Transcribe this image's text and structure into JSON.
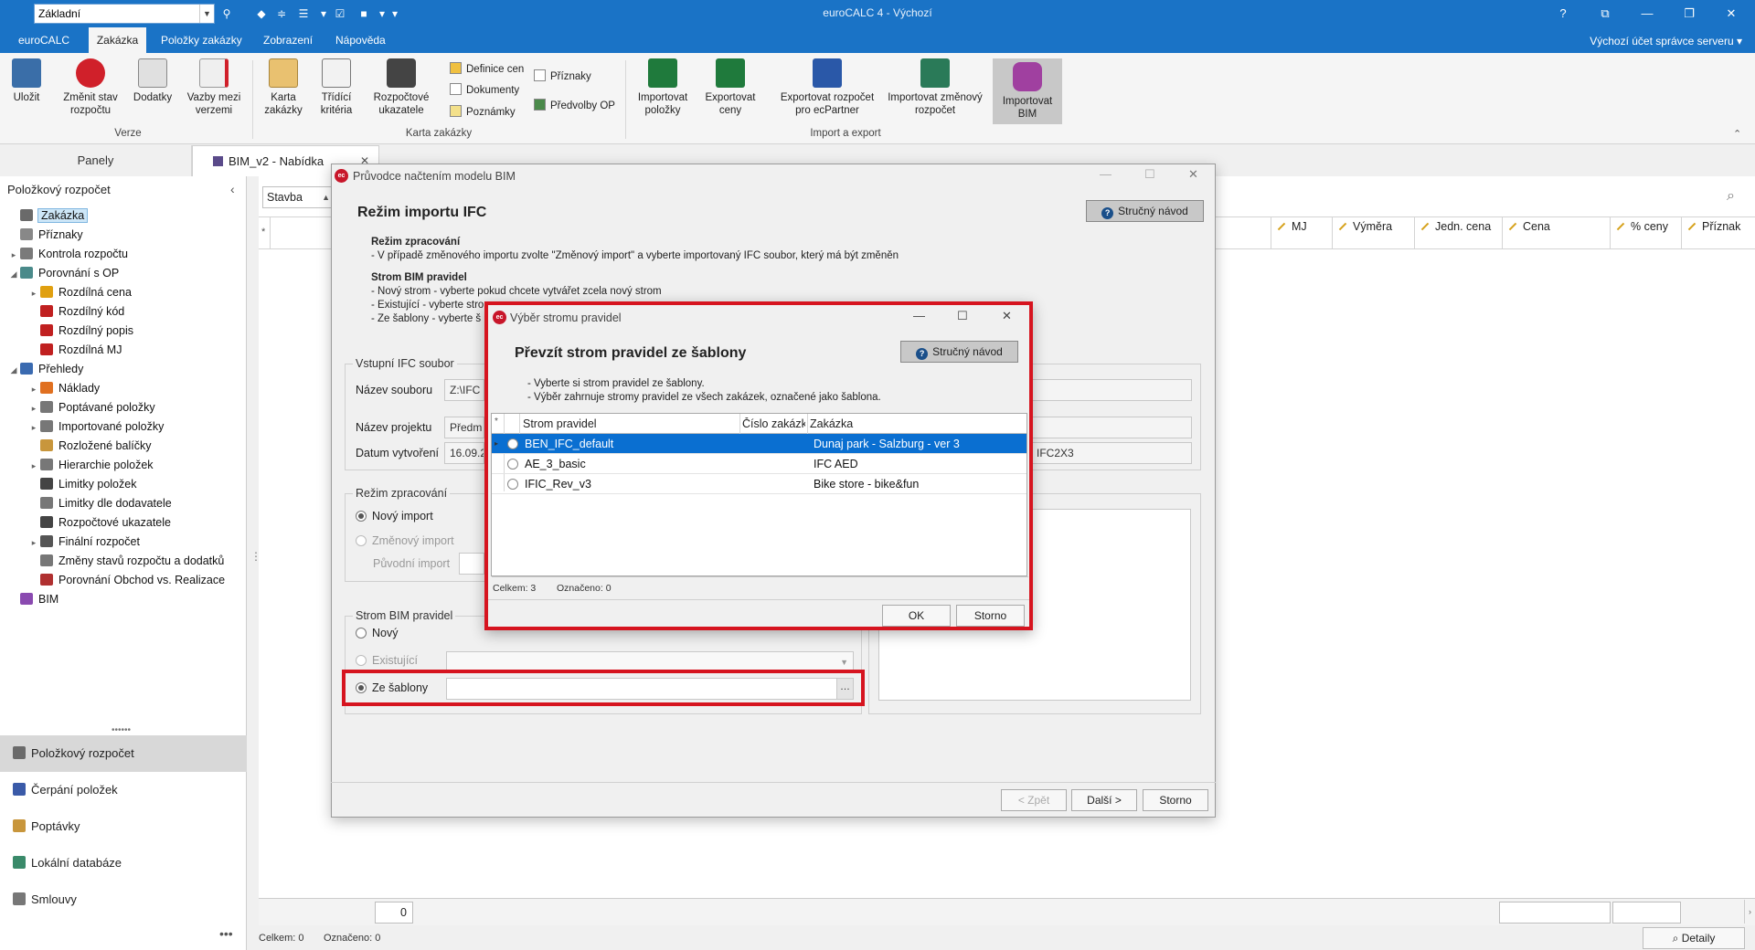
{
  "app": {
    "title": "euroCALC 4 - Výchozí",
    "profile": "Základní",
    "account": "Výchozí účet správce serveru"
  },
  "ribbon": {
    "tabs": [
      "euroCALC",
      "Zakázka",
      "Položky zakázky",
      "Zobrazení",
      "Nápověda"
    ],
    "groups": {
      "verze": {
        "label": "Verze",
        "buttons": [
          "Uložit",
          "Změnit stav rozpočtu",
          "Dodatky",
          "Vazby mezi verzemi"
        ]
      },
      "karta": {
        "label": "Karta zakázky",
        "buttons": [
          "Karta zakázky",
          "Třídící kritéria",
          "Rozpočtové ukazatele"
        ],
        "small": [
          "Definice cen",
          "Dokumenty",
          "Poznámky",
          "Příznaky",
          "Předvolby OP"
        ]
      },
      "import": {
        "label": "Import a export",
        "buttons": [
          "Importovat položky",
          "Exportovat ceny",
          "Exportovat rozpočet pro ecPartner",
          "Importovat změnový rozpočet",
          "Importovat BIM"
        ]
      }
    }
  },
  "left": {
    "panels_label": "Panely",
    "title": "Položkový rozpočet",
    "tree": [
      {
        "label": "Zakázka",
        "level": 0,
        "selected": true,
        "color": "#6a6a6a"
      },
      {
        "label": "Příznaky",
        "level": 0,
        "color": "#888888"
      },
      {
        "label": "Kontrola rozpočtu",
        "level": 0,
        "exp": "▸",
        "color": "#7a7a7a"
      },
      {
        "label": "Porovnání s OP",
        "level": 0,
        "exp": "◢",
        "color": "#4a8a8a"
      },
      {
        "label": "Rozdílná cena",
        "level": 1,
        "exp": "▸",
        "color": "#e0a010"
      },
      {
        "label": "Rozdílný kód",
        "level": 1,
        "color": "#c02020"
      },
      {
        "label": "Rozdílný popis",
        "level": 1,
        "color": "#c02020"
      },
      {
        "label": "Rozdílná MJ",
        "level": 1,
        "color": "#c02020"
      },
      {
        "label": "Přehledy",
        "level": 0,
        "exp": "◢",
        "color": "#3a6ab0"
      },
      {
        "label": "Náklady",
        "level": 1,
        "exp": "▸",
        "color": "#e07020"
      },
      {
        "label": "Poptávané položky",
        "level": 1,
        "exp": "▸",
        "color": "#777777"
      },
      {
        "label": "Importované položky",
        "level": 1,
        "exp": "▸",
        "color": "#777777"
      },
      {
        "label": "Rozložené balíčky",
        "level": 1,
        "color": "#c8963c"
      },
      {
        "label": "Hierarchie položek",
        "level": 1,
        "exp": "▸",
        "color": "#777777"
      },
      {
        "label": "Limitky položek",
        "level": 1,
        "color": "#444444"
      },
      {
        "label": "Limitky dle dodavatele",
        "level": 1,
        "color": "#777777"
      },
      {
        "label": "Rozpočtové ukazatele",
        "level": 1,
        "color": "#444444"
      },
      {
        "label": "Finální rozpočet",
        "level": 1,
        "exp": "▸",
        "color": "#555555"
      },
      {
        "label": "Změny stavů rozpočtu a dodatků",
        "level": 1,
        "color": "#777777"
      },
      {
        "label": "Porovnání Obchod vs. Realizace",
        "level": 1,
        "color": "#b03030"
      },
      {
        "label": "BIM",
        "level": 0,
        "color": "#8a4ab0"
      }
    ],
    "nav": [
      "Položkový rozpočet",
      "Čerpání položek",
      "Poptávky",
      "Lokální databáze",
      "Smlouvy"
    ]
  },
  "doc": {
    "tab": "BIM_v2 - Nabídka",
    "filter": "Stavba",
    "columns": [
      "MJ",
      "Výměra",
      "Jedn. cena",
      "Cena",
      "% ceny",
      "Příznak"
    ],
    "counter": "0",
    "status_total": "Celkem: 0",
    "status_marked": "Označeno: 0",
    "detail_button": "Detaily"
  },
  "wizard": {
    "title": "Průvodce načtením modelu BIM",
    "heading": "Režim importu IFC",
    "help": "Stručný návod",
    "info_heading1": "Režim zpracování",
    "info_line1": "- V případě změnového importu zvolte \"Změnový import\" a vyberte importovaný IFC soubor, který má být změněn",
    "info_heading2": "Strom BIM pravidel",
    "info_lines2": [
      "- Nový strom - vyberte pokud chcete vytvářet zcela nový strom",
      "- Existující - vyberte strom",
      "- Ze šablony - vyberte š"
    ],
    "ifc_group": "Vstupní IFC soubor",
    "file_label": "Název souboru",
    "file_value": "Z:\\IFC",
    "project_label": "Název projektu",
    "project_value": "Předm",
    "date_label": "Datum vytvoření",
    "date_value": "16.09.2",
    "schema_value": "IFC2X3",
    "mode_group": "Režim zpracování",
    "mode_new": "Nový import",
    "mode_change": "Změnový import",
    "orig_import": "Původní import",
    "tree_group": "Strom BIM pravidel",
    "tree_new": "Nový",
    "tree_existing": "Existující",
    "tree_template": "Ze šablony",
    "btn_back": "< Zpět",
    "btn_next": "Další >",
    "btn_cancel": "Storno"
  },
  "inner": {
    "title": "Výběr stromu pravidel",
    "heading": "Převzít strom pravidel ze šablony",
    "help": "Stručný návod",
    "info": [
      "- Vyberte si strom pravidel ze šablony.",
      "- Výběr zahrnuje stromy pravidel ze všech zakázek, označené jako šablona."
    ],
    "columns": [
      "Strom pravidel",
      "Číslo zakázk",
      "Zakázka"
    ],
    "rows": [
      {
        "tree": "BEN_IFC_default",
        "number": "",
        "order": "Dunaj park - Salzburg - ver 3",
        "selected": true
      },
      {
        "tree": "AE_3_basic",
        "number": "",
        "order": "IFC AED",
        "selected": false
      },
      {
        "tree": "IFIC_Rev_v3",
        "number": "",
        "order": "Bike store - bike&fun",
        "selected": false
      }
    ],
    "total": "Celkem: 3",
    "marked": "Označeno: 0",
    "ok": "OK",
    "cancel": "Storno"
  },
  "colors": {
    "accent": "#1a73c6",
    "highlight": "#d6141f",
    "selection": "#0a6fd1"
  }
}
